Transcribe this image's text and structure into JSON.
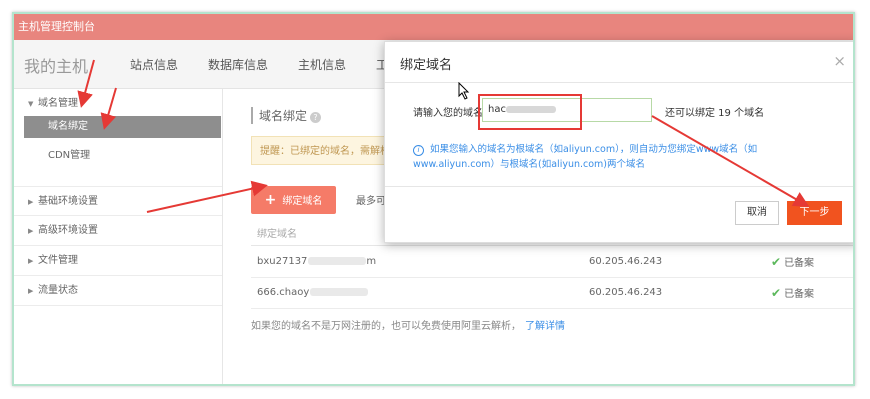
{
  "window": {
    "title": "主机管理控制台"
  },
  "nav": {
    "brand": "我的主机",
    "links": [
      "站点信息",
      "数据库信息",
      "主机信息",
      "工"
    ]
  },
  "sidebar": {
    "groups": [
      {
        "label": "域名管理",
        "items": [
          {
            "label": "域名绑定",
            "active": true
          },
          {
            "label": "CDN管理",
            "active": false
          }
        ]
      },
      {
        "label": "基础环境设置"
      },
      {
        "label": "高级环境设置"
      },
      {
        "label": "文件管理"
      },
      {
        "label": "流量状态"
      }
    ]
  },
  "main": {
    "section_title": "域名绑定",
    "notice": "提醒：已绑定的域名，需解析",
    "bind_button": "绑定域名",
    "max_text": "最多可",
    "table": {
      "header": "绑定域名",
      "rows": [
        {
          "domain_prefix": "bxu27137",
          "domain_suffix": "m",
          "ip": "60.205.46.243",
          "status": "已备案"
        },
        {
          "domain_prefix": "666.chaoy",
          "domain_suffix": "",
          "ip": "60.205.46.243",
          "status": "已备案"
        }
      ]
    },
    "footer_text": "如果您的域名不是万网注册的，也可以免费使用阿里云解析，",
    "footer_link": "了解详情"
  },
  "dialog": {
    "title": "绑定域名",
    "close": "×",
    "input_label": "请输入您的域名：",
    "input_value": "hac",
    "remaining": "还可以绑定 19 个域名",
    "tip_line1": "如果您输入的域名为根域名（如aliyun.com），则自动为您绑定www域名（如",
    "tip_line2": "www.aliyun.com）与根域名(如aliyun.com)两个域名",
    "cancel": "取消",
    "next": "下一步"
  },
  "colors": {
    "topbar": "#e8857e",
    "accent": "#f57b68",
    "next_button": "#f1531f",
    "link": "#3a8ee6",
    "annotation": "#e53935"
  },
  "icons": [
    "plus-icon",
    "question-icon",
    "caret-right-icon",
    "check-icon",
    "info-icon",
    "close-icon",
    "cursor-icon"
  ]
}
